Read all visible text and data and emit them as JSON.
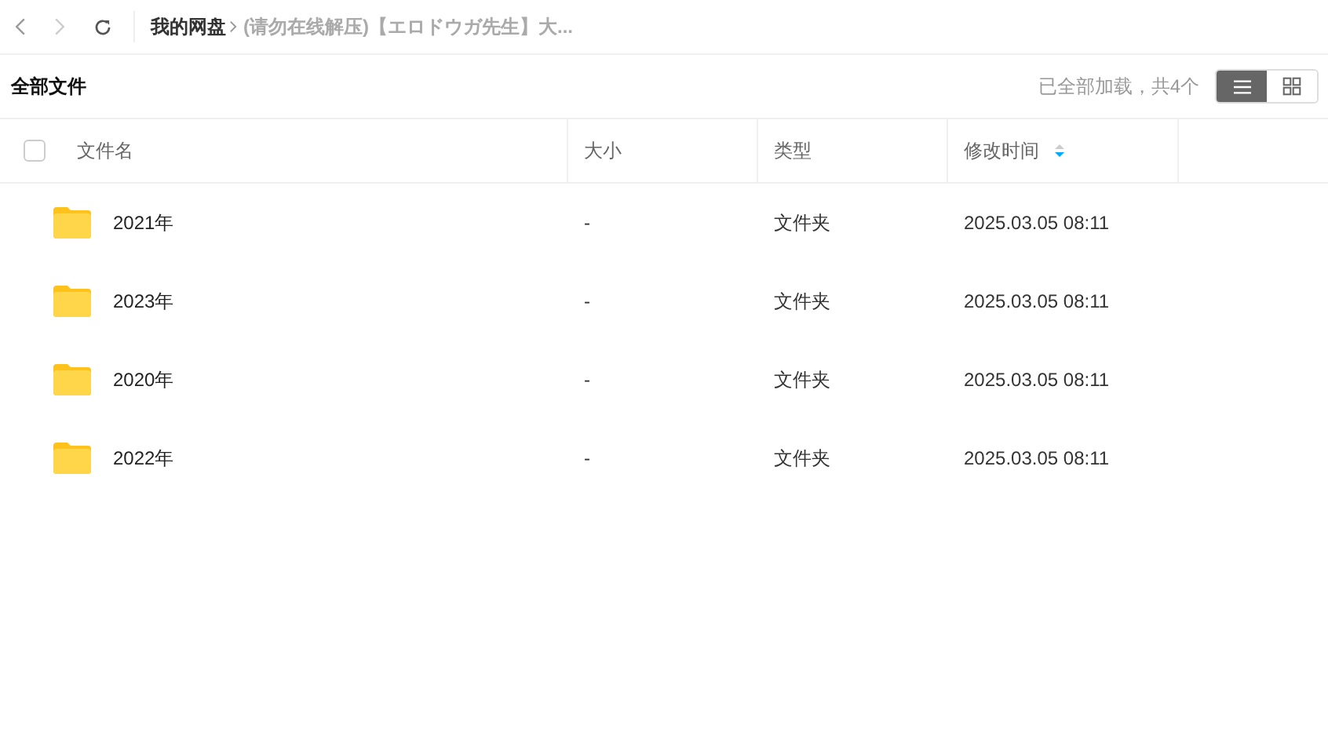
{
  "nav": {
    "back_disabled": false,
    "forward_disabled": true
  },
  "breadcrumbs": [
    {
      "label": "我的网盘",
      "current": false
    },
    {
      "label": "(请勿在线解压)【エロドウガ先生】大...",
      "current": true
    }
  ],
  "title": "全部文件",
  "load_status": "已全部加载，共4个",
  "view_modes": [
    {
      "kind": "list",
      "selected": true
    },
    {
      "kind": "grid",
      "selected": false
    }
  ],
  "table": {
    "select_all_checked": false,
    "columns": [
      {
        "label": "文件名"
      },
      {
        "label": "大小"
      },
      {
        "label": "类型"
      },
      {
        "label": "修改时间",
        "sort_descending": true
      }
    ],
    "rows": [
      {
        "name": "2021年",
        "size": "-",
        "type": "文件夹",
        "modified": "2025.03.05 08:11"
      },
      {
        "name": "2023年",
        "size": "-",
        "type": "文件夹",
        "modified": "2025.03.05 08:11"
      },
      {
        "name": "2020年",
        "size": "-",
        "type": "文件夹",
        "modified": "2025.03.05 08:11"
      },
      {
        "name": "2022年",
        "size": "-",
        "type": "文件夹",
        "modified": "2025.03.05 08:11"
      }
    ]
  }
}
